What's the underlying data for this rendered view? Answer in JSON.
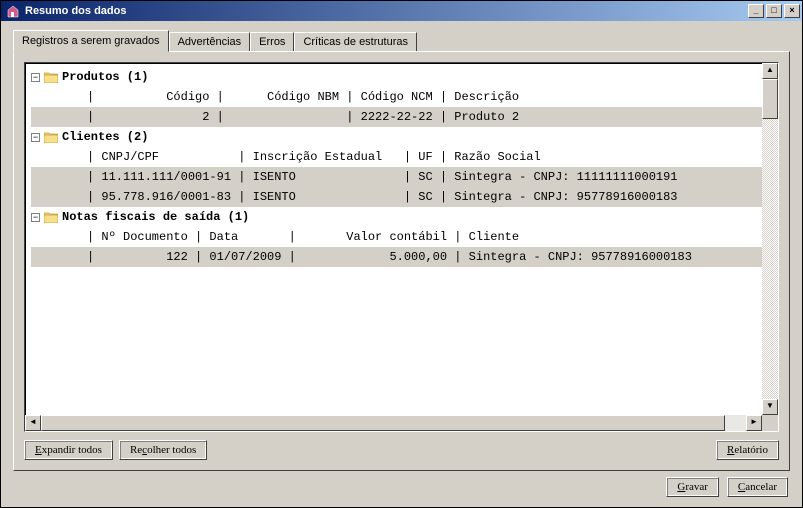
{
  "window": {
    "title": "Resumo dos dados"
  },
  "tabs": [
    {
      "label": "Registros a serem gravados",
      "active": true
    },
    {
      "label": "Advertências",
      "active": false
    },
    {
      "label": "Erros",
      "active": false
    },
    {
      "label": "Críticas de estruturas",
      "active": false
    }
  ],
  "tree": {
    "sections": [
      {
        "title": "Produtos (1)",
        "header": "|          Código |      Código NBM | Código NCM | Descrição",
        "rows": [
          "|               2 |                 | 2222-22-22 | Produto 2"
        ]
      },
      {
        "title": "Clientes (2)",
        "header": "| CNPJ/CPF           | Inscrição Estadual   | UF | Razão Social",
        "rows": [
          "| 11.111.111/0001-91 | ISENTO               | SC | Sintegra - CNPJ: 11111111000191",
          "| 95.778.916/0001-83 | ISENTO               | SC | Sintegra - CNPJ: 95778916000183"
        ]
      },
      {
        "title": "Notas fiscais de saída (1)",
        "header": "| Nº Documento | Data       |       Valor contábil | Cliente",
        "rows": [
          "|          122 | 01/07/2009 |             5.000,00 | Sintegra - CNPJ: 95778916000183"
        ]
      }
    ]
  },
  "buttons": {
    "expand_all": "Expandir todos",
    "collapse_all": "Recolher todos",
    "report": "Relatório",
    "save": "Gravar",
    "cancel": "Cancelar"
  }
}
